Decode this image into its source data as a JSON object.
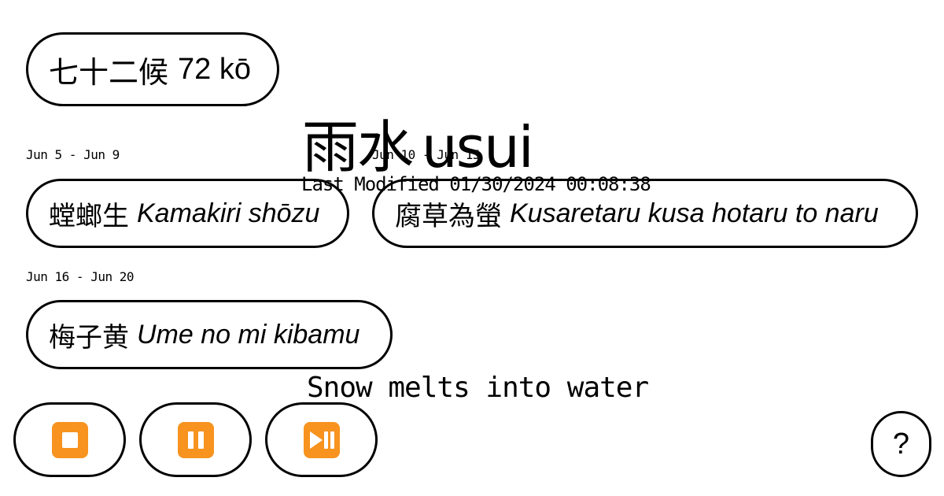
{
  "header": {
    "title_kanji": "七十二候",
    "title_romaji": "72 kō"
  },
  "season": {
    "kanji": "雨水",
    "romaji": "usui",
    "last_modified": "Last Modified 01/30/2024 00:08:38",
    "meaning": "Snow melts into water"
  },
  "kou": [
    {
      "dates": "Jun 5 - Jun 9",
      "kanji": "螳螂生",
      "romaji": "Kamakiri shōzu"
    },
    {
      "dates": "Jun 10 - Jun 15",
      "kanji": "腐草為螢",
      "romaji": "Kusaretaru kusa hotaru to naru"
    },
    {
      "dates": "Jun 16 - Jun 20",
      "kanji": "梅子黄",
      "romaji": "Ume no mi kibamu"
    }
  ],
  "controls": {
    "stop_icon": "stop-button-icon",
    "pause_icon": "pause-button-icon",
    "play_pause_icon": "play-pause-button-icon",
    "accent_color": "#f7931e",
    "help_label": "?"
  }
}
